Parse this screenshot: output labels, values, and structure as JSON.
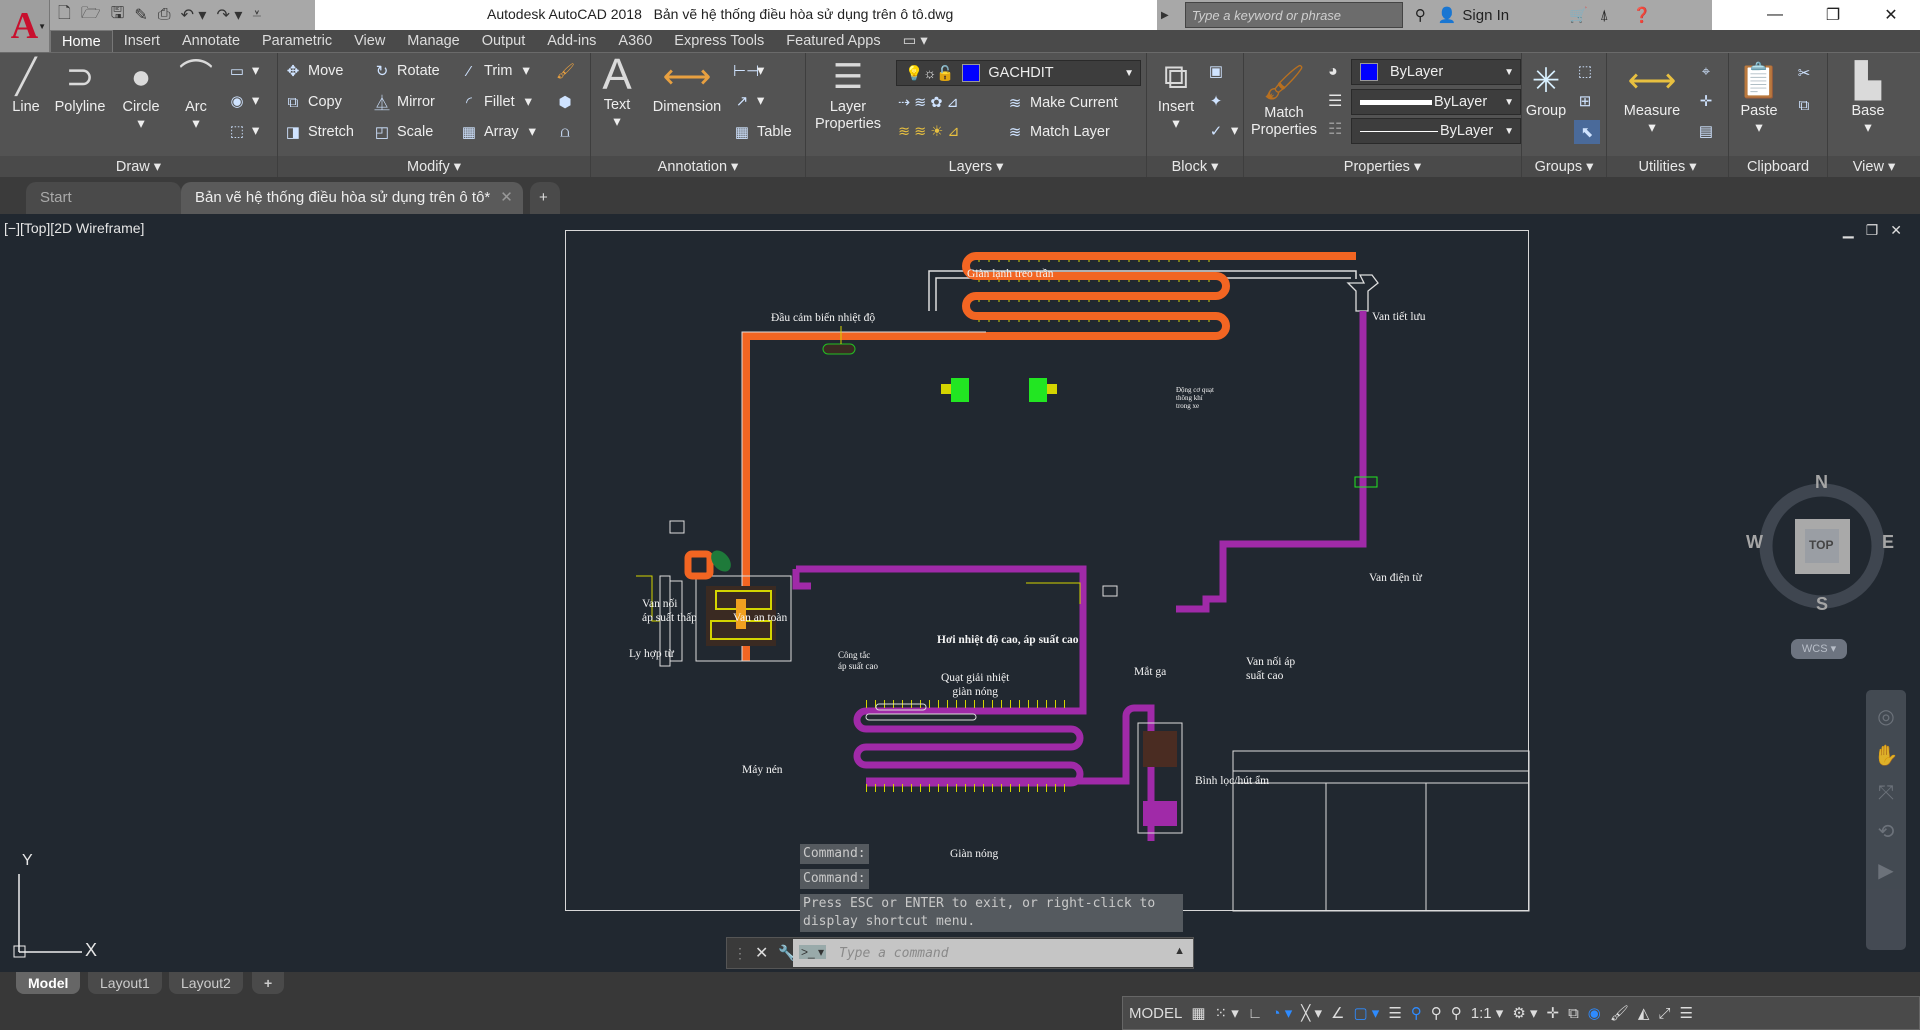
{
  "app": {
    "title": "Autodesk AutoCAD 2018",
    "document": "Bản vẽ hệ thống điều hòa sử dụng trên ô tô.dwg",
    "logo": "A"
  },
  "quick_access": [
    "new-icon",
    "open-icon",
    "save-icon",
    "save-as-icon",
    "plot-icon",
    "undo-icon",
    "redo-icon",
    "customize-icon"
  ],
  "search": {
    "placeholder": "Type a keyword or phrase",
    "sign_in": "Sign In"
  },
  "ribbon_tabs": [
    "Home",
    "Insert",
    "Annotate",
    "Parametric",
    "View",
    "Manage",
    "Output",
    "Add-ins",
    "A360",
    "Express Tools",
    "Featured Apps"
  ],
  "active_tab": "Home",
  "panels": {
    "draw": {
      "label": "Draw ▾",
      "tools": [
        "Line",
        "Polyline",
        "Circle",
        "Arc"
      ]
    },
    "modify": {
      "label": "Modify ▾",
      "tools": [
        "Move",
        "Rotate",
        "Trim",
        "Copy",
        "Mirror",
        "Fillet",
        "Stretch",
        "Scale",
        "Array"
      ]
    },
    "annotation": {
      "label": "Annotation ▾",
      "tools": [
        "Text",
        "Dimension",
        "Table"
      ]
    },
    "layers": {
      "label": "Layers ▾",
      "tool": "Layer Properties",
      "current_layer": "GACHDIT",
      "make_current": "Make Current",
      "match_layer": "Match Layer",
      "layer_color": "#0000ff"
    },
    "block": {
      "label": "Block ▾",
      "tool": "Insert"
    },
    "properties": {
      "label": "Properties ▾",
      "tool": "Match Properties",
      "color": "ByLayer",
      "lineweight": "ByLayer",
      "linetype": "ByLayer",
      "color_swatch": "#0000ff"
    },
    "groups": {
      "label": "Groups ▾",
      "tool": "Group"
    },
    "utilities": {
      "label": "Utilities ▾",
      "tool": "Measure"
    },
    "clipboard": {
      "label": "Clipboard",
      "tool": "Paste"
    },
    "view": {
      "label": "View ▾",
      "tool": "Base"
    }
  },
  "file_tabs": {
    "start": "Start",
    "active": "Bản vẽ hệ thống điều hòa sử dụng trên ô tô*"
  },
  "viewport": {
    "label": "[−][Top][2D Wireframe]"
  },
  "viewcube": {
    "n": "N",
    "s": "S",
    "e": "E",
    "w": "W",
    "face": "TOP",
    "wcs": "WCS ▾"
  },
  "drawing_labels": {
    "evaporator": "Giàn lạnh treo trần",
    "temp_sensor": "Đầu cảm biến nhiệt độ",
    "expansion_valve": "Van tiết lưu",
    "fan_motor_1": "Động cơ quạt",
    "fan_motor_2": "thông khí",
    "fan_motor_3": "trong xe",
    "solenoid_valve": "Van điện từ",
    "low_port_1": "Van nối",
    "low_port_2": "áp suất thấp",
    "safety_valve": "Van an toàn",
    "clutch": "Ly hợp từ",
    "hot_gas": "Hơi nhiệt độ cao, áp suất cao",
    "pressure_switch_1": "Công tắc",
    "pressure_switch_2": "áp suất cao",
    "condenser_fan_1": "Quạt giải nhiệt",
    "condenser_fan_2": "giàn nóng",
    "sight_glass": "Mắt ga",
    "high_port_1": "Van nối áp",
    "high_port_2": "suất cao",
    "compressor": "Máy nén",
    "receiver_drier": "Bình lọc/hút ẩm",
    "condenser": "Giàn nóng"
  },
  "colors": {
    "low_pressure": "#f26522",
    "high_pressure": "#a02aa8",
    "fan_motor": "#22e622",
    "leader": "#d4d400"
  },
  "command_history": [
    "Command:",
    "Command:",
    "Press ESC or ENTER to exit, or right-click to display shortcut menu."
  ],
  "command_input": {
    "placeholder": "Type a command"
  },
  "layout_tabs": [
    "Model",
    "Layout1",
    "Layout2",
    "+"
  ],
  "status": {
    "model": "MODEL",
    "scale": "1:1 ▾"
  },
  "ucs": {
    "x": "X",
    "y": "Y"
  }
}
